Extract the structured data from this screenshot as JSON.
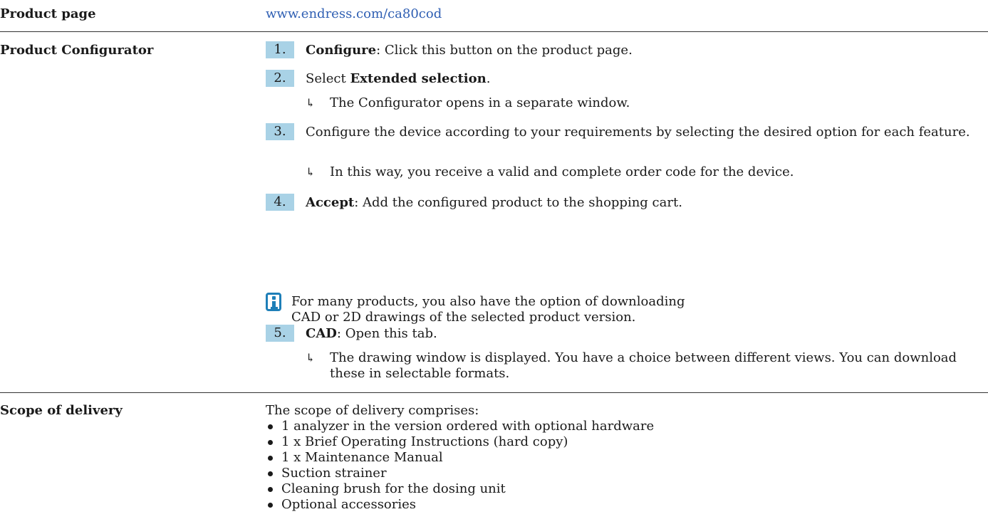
{
  "product_page": {
    "label": "Product page",
    "url": "www.endress.com/ca80cod"
  },
  "configurator": {
    "label": "Product Configurator",
    "steps": [
      {
        "num": "1.",
        "bold": "Configure",
        "text": ": Click this button on the product page."
      },
      {
        "num": "2.",
        "pre": "Select ",
        "bold": "Extended selection",
        "text": "."
      },
      {
        "num": "3.",
        "text": "Configure the device according to your requirements by selecting the desired option for each feature."
      },
      {
        "num": "4.",
        "bold": "Accept",
        "text": ": Add the configured product to the shopping cart."
      },
      {
        "num": "5.",
        "bold": "CAD",
        "text": ": Open this tab."
      }
    ],
    "results": [
      "The Configurator opens in a separate window.",
      "In this way, you receive a valid and complete order code for the device.",
      "The drawing window is displayed. You have a choice between different views. You can download these in selectable formats."
    ],
    "result_arrow": "↳",
    "note": {
      "icon": "info-icon",
      "text": "For many products, you also have the option of downloading CAD or 2D drawings of the selected product version."
    }
  },
  "scope": {
    "label": "Scope of delivery",
    "intro": "The scope of delivery comprises:",
    "items": [
      "1 analyzer in the version ordered with optional hardware",
      "1 x Brief Operating Instructions (hard copy)",
      "1 x Maintenance Manual",
      "Suction strainer",
      "Cleaning brush for the dosing unit",
      "Optional accessories"
    ]
  },
  "colors": {
    "step_badge": "#a9d2e6",
    "link": "#2f5fb3",
    "info_icon": "#1e7fb8"
  }
}
